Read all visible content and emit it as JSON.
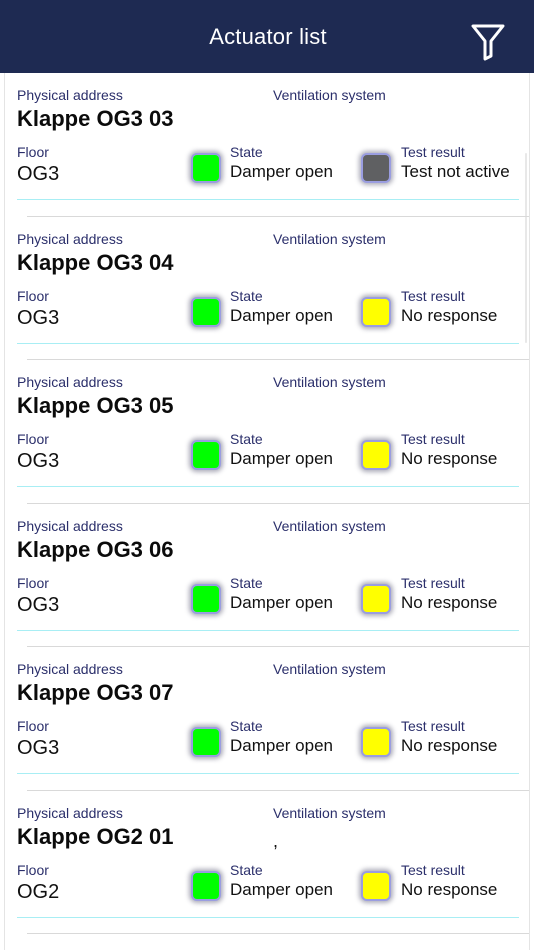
{
  "header": {
    "title": "Actuator list",
    "filter_icon": "filter-icon"
  },
  "labels": {
    "physical_address": "Physical address",
    "ventilation_system": "Ventilation system",
    "floor": "Floor",
    "state": "State",
    "test_result": "Test result"
  },
  "colors": {
    "header_bg": "#1e2a52",
    "state_ok": "#00ff00",
    "test_inactive": "#5f6062",
    "test_no_response": "#ffff00"
  },
  "items": [
    {
      "name": "Klappe OG3 03",
      "ventilation": "",
      "floor": "OG3",
      "state": "Damper open",
      "state_color": "#00ff00",
      "test_result": "Test not active",
      "test_color": "#5f6062"
    },
    {
      "name": "Klappe OG3 04",
      "ventilation": "",
      "floor": "OG3",
      "state": "Damper open",
      "state_color": "#00ff00",
      "test_result": "No response",
      "test_color": "#ffff00"
    },
    {
      "name": "Klappe OG3 05",
      "ventilation": "",
      "floor": "OG3",
      "state": "Damper open",
      "state_color": "#00ff00",
      "test_result": "No response",
      "test_color": "#ffff00"
    },
    {
      "name": "Klappe OG3 06",
      "ventilation": "",
      "floor": "OG3",
      "state": "Damper open",
      "state_color": "#00ff00",
      "test_result": "No response",
      "test_color": "#ffff00"
    },
    {
      "name": "Klappe OG3 07",
      "ventilation": "",
      "floor": "OG3",
      "state": "Damper open",
      "state_color": "#00ff00",
      "test_result": "No response",
      "test_color": "#ffff00"
    },
    {
      "name": "Klappe OG2 01",
      "ventilation": ",",
      "floor": "OG2",
      "state": "Damper open",
      "state_color": "#00ff00",
      "test_result": "No response",
      "test_color": "#ffff00"
    }
  ]
}
